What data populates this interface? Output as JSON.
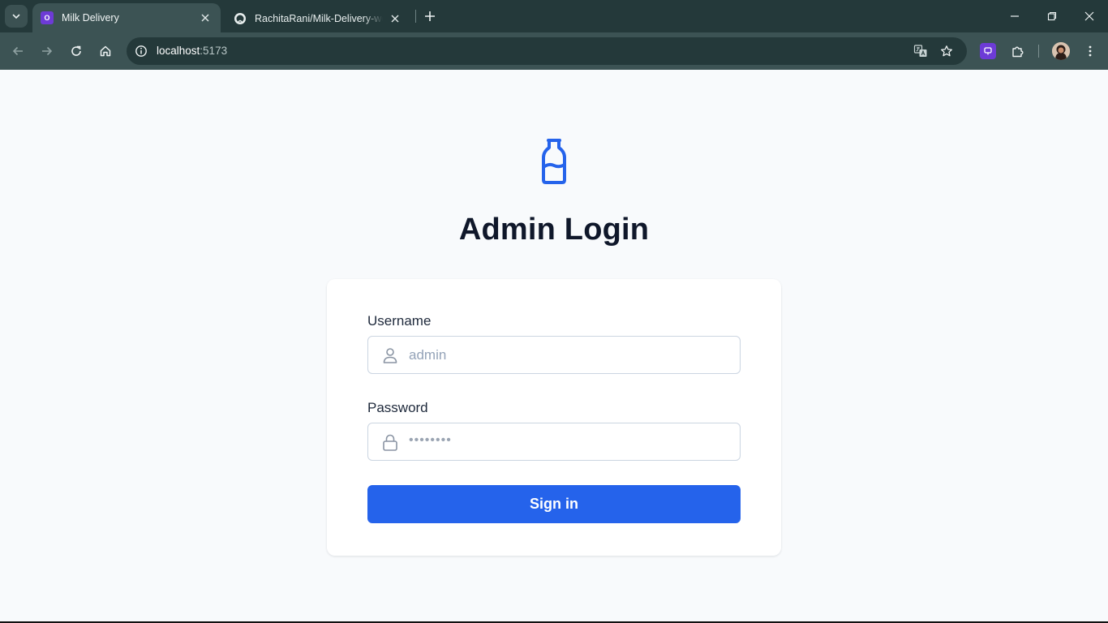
{
  "browser": {
    "tabs": [
      {
        "title": "Milk Delivery",
        "favicon_letter": "O",
        "active": true
      },
      {
        "title": "RachitaRani/Milk-Delivery-web",
        "active": false
      }
    ],
    "address": {
      "host": "localhost",
      "port": ":5173"
    }
  },
  "page": {
    "title": "Admin Login",
    "username": {
      "label": "Username",
      "placeholder": "admin"
    },
    "password": {
      "label": "Password",
      "placeholder": "••••••••"
    },
    "signin_label": "Sign in"
  },
  "colors": {
    "accent": "#2563eb",
    "title": "#0f172a",
    "page_bg": "#f8fafc",
    "chrome_dark": "#24393a",
    "chrome_toolbar": "#3c5354"
  }
}
